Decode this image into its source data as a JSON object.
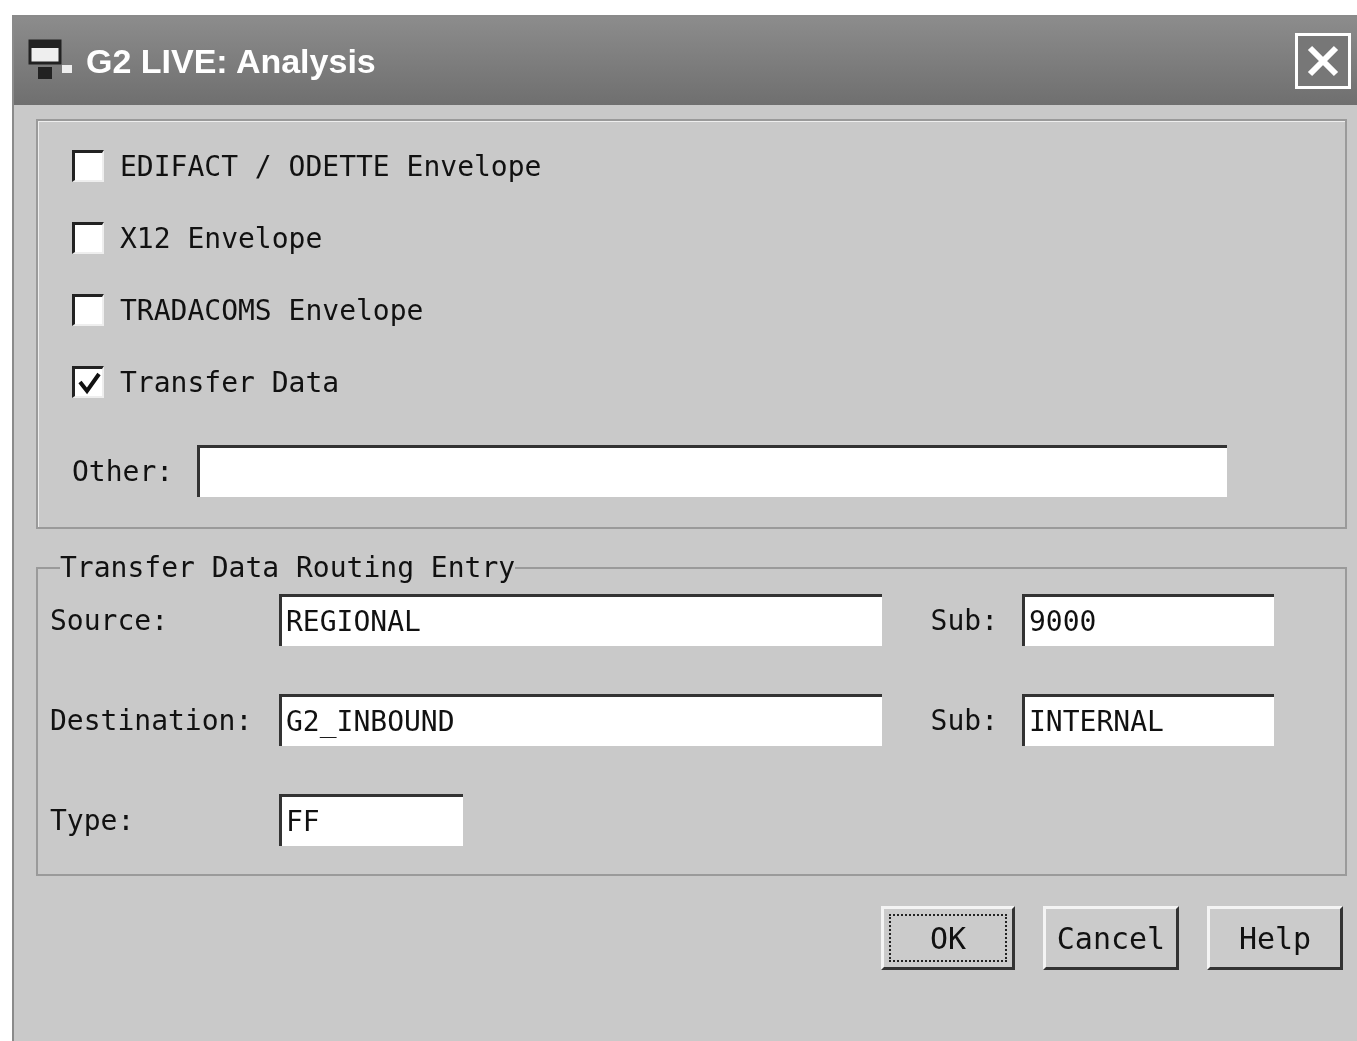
{
  "window": {
    "title": "G2 LIVE: Analysis"
  },
  "options": [
    {
      "label": "EDIFACT / ODETTE Envelope",
      "checked": false
    },
    {
      "label": "X12 Envelope",
      "checked": false
    },
    {
      "label": "TRADACOMS Envelope",
      "checked": false
    },
    {
      "label": "Transfer Data",
      "checked": true
    }
  ],
  "other": {
    "label": "Other:"
  },
  "routing": {
    "title": "Transfer Data Routing Entry",
    "rows": [
      {
        "label": "Source:",
        "value": "REGIONAL",
        "sub_label": "Sub:",
        "sub_value": "9000"
      },
      {
        "label": "Destination:",
        "value": "G2_INBOUND",
        "sub_label": "Sub:",
        "sub_value": "INTERNAL"
      },
      {
        "label": "Type:",
        "value": "FF"
      }
    ]
  },
  "buttons": [
    {
      "label": "OK",
      "focused": true
    },
    {
      "label": "Cancel",
      "focused": false
    },
    {
      "label": "Help",
      "focused": false
    }
  ]
}
